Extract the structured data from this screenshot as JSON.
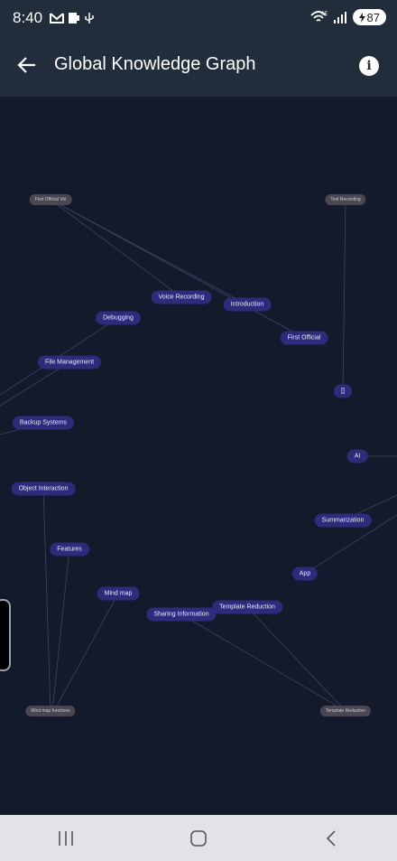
{
  "status_bar": {
    "time": "8:40",
    "network": "6E",
    "battery": "87"
  },
  "app_bar": {
    "title": "Global Knowledge Graph"
  },
  "graph": {
    "nodes": [
      {
        "id": "first-official-voi",
        "label": "First Official Voi",
        "style": "grey"
      },
      {
        "id": "text-recording",
        "label": "Text Recording",
        "style": "grey"
      },
      {
        "id": "voice-recording",
        "label": "Voice Recording",
        "style": "normal"
      },
      {
        "id": "introduction",
        "label": "Introduction",
        "style": "normal"
      },
      {
        "id": "debugging",
        "label": "Debugging",
        "style": "normal"
      },
      {
        "id": "first-official",
        "label": "First Official",
        "style": "normal"
      },
      {
        "id": "file-management",
        "label": "File Management",
        "style": "normal"
      },
      {
        "id": "box",
        "label": "[]",
        "style": "normal"
      },
      {
        "id": "backup-systems",
        "label": "Backup Systems",
        "style": "normal"
      },
      {
        "id": "ai",
        "label": "AI",
        "style": "normal"
      },
      {
        "id": "object-interaction",
        "label": "Object Interaction",
        "style": "normal"
      },
      {
        "id": "summarization",
        "label": "Summarization",
        "style": "normal"
      },
      {
        "id": "features",
        "label": "Features",
        "style": "normal"
      },
      {
        "id": "app",
        "label": "App",
        "style": "normal"
      },
      {
        "id": "mind-map",
        "label": "Mind map",
        "style": "normal"
      },
      {
        "id": "template-reduction",
        "label": "Template Reduction",
        "style": "normal"
      },
      {
        "id": "sharing-information",
        "label": "Sharing Information",
        "style": "normal"
      },
      {
        "id": "mind-map-functions",
        "label": "Mind map functions",
        "style": "grey"
      },
      {
        "id": "template-reduction-2",
        "label": "Template Reduction",
        "style": "grey"
      }
    ]
  },
  "nav_bar": {
    "recents": "recents-icon",
    "home": "home-icon",
    "back": "back-icon"
  }
}
